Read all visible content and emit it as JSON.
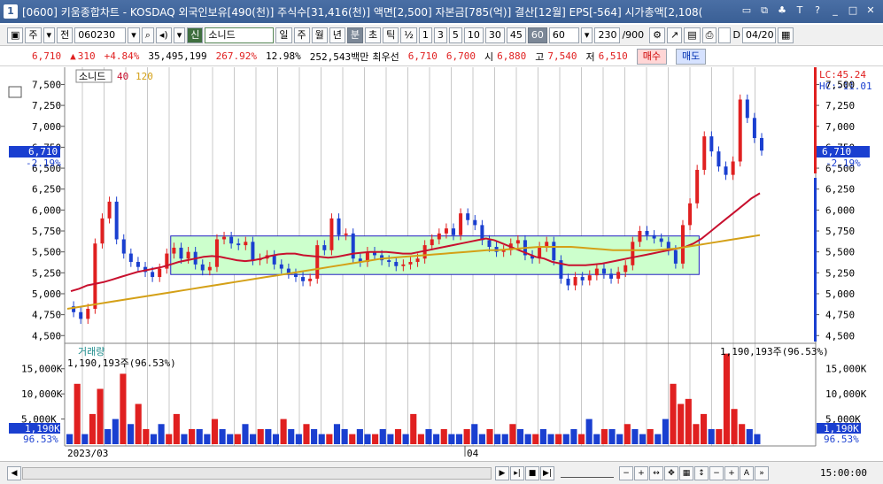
{
  "window": {
    "badge": "1",
    "title": "[0600] 키움종합차트 - KOSDAQ 외국인보유[490(천)] 주식수[31,416(천)] 액면[2,500] 자본금[785(억)] 결산[12월] EPS[-564] 시가총액[2,108(",
    "buttons": [
      "▭",
      "⧉",
      "♣",
      "T",
      "?",
      "_",
      "□",
      "✕"
    ]
  },
  "toolbar": {
    "period_label": "주",
    "prev_label": "전",
    "code": "060230",
    "name_tag": "신",
    "name": "소니드",
    "periods": [
      "일",
      "주",
      "월",
      "년",
      "분",
      "초",
      "틱"
    ],
    "active_period": "분",
    "half": "½",
    "intervals": [
      "1",
      "3",
      "5",
      "10",
      "30",
      "45",
      "60"
    ],
    "active_interval": "60",
    "interval_value": "60",
    "count": "230",
    "count_max": "/900",
    "d_label": "D",
    "date": "04/20"
  },
  "quote": {
    "price": "6,710",
    "change_arrow": "▲",
    "change": "310",
    "change_pct": "+4.84%",
    "volume": "35,495,199",
    "vol_ratio": "267.92%",
    "turnover": "12.98%",
    "amount": "252,543백만",
    "best_ask_label": "최우선",
    "best_ask": "6,710",
    "best_bid": "6,700",
    "open_label": "시",
    "open": "6,880",
    "high_label": "고",
    "high": "7,540",
    "low_label": "저",
    "low": "6,510",
    "buy_label": "매수",
    "sell_label": "매도"
  },
  "legend": {
    "name": "소니드",
    "ma1": "40",
    "ma2": "120",
    "lc": "LC:45.24",
    "hc": "HC:-11.01",
    "volume_title": "거래량",
    "volume_value": "1,190,193주(96.53%)",
    "volume_value_right": "1,190,193주(96.53%)"
  },
  "price_axis": {
    "ticks": [
      "7,500",
      "7,250",
      "7,000",
      "6,750",
      "6,500",
      "6,250",
      "6,000",
      "5,750",
      "5,500",
      "5,250",
      "5,000",
      "4,750",
      "4,500"
    ],
    "current_price": "6,710",
    "current_pct": "-2.19%"
  },
  "volume_axis": {
    "ticks": [
      "15,000K",
      "10,000K",
      "5,000K"
    ],
    "current": "1,190K",
    "current_pct": "96.53%"
  },
  "time_axis": {
    "labels": [
      "2023/03",
      "04"
    ],
    "time": "15:00:00"
  },
  "colors": {
    "up": "#e02020",
    "down": "#1a3fd0",
    "ma40": "#c8102e",
    "ma120": "#d4a017",
    "box_fill": "#ccffcc",
    "box_stroke": "#2020c0"
  },
  "chart_data": {
    "type": "candlestick",
    "y_range": [
      4450,
      7600
    ],
    "volume_range": [
      0,
      19000
    ],
    "price_path": [
      4850,
      4780,
      4700,
      4820,
      5600,
      5900,
      6100,
      5650,
      5480,
      5380,
      5320,
      5260,
      5200,
      5300,
      5480,
      5550,
      5420,
      5500,
      5350,
      5280,
      5320,
      5650,
      5680,
      5600,
      5580,
      5620,
      5400,
      5420,
      5460,
      5350,
      5300,
      5240,
      5200,
      5150,
      5180,
      5580,
      5520,
      5900,
      5700,
      5720,
      5420,
      5380,
      5500,
      5460,
      5400,
      5380,
      5330,
      5350,
      5380,
      5420,
      5580,
      5650,
      5720,
      5780,
      5700,
      5960,
      5880,
      5820,
      5640,
      5560,
      5500,
      5520,
      5600,
      5640,
      5460,
      5420,
      5560,
      5620,
      5400,
      5180,
      5100,
      5200,
      5160,
      5220,
      5300,
      5240,
      5180,
      5260,
      5340,
      5620,
      5750,
      5700,
      5660,
      5620,
      5520,
      5360,
      5820,
      6080,
      6480,
      6880,
      6700,
      6520,
      6420,
      6580,
      7320,
      7100,
      6860,
      6710
    ],
    "ma40_path": [
      5030,
      5060,
      5100,
      5120,
      5140,
      5170,
      5200,
      5230,
      5260,
      5280,
      5300,
      5320,
      5350,
      5380,
      5400,
      5420,
      5440,
      5450,
      5440,
      5420,
      5400,
      5390,
      5400,
      5420,
      5450,
      5470,
      5480,
      5480,
      5460,
      5450,
      5440,
      5430,
      5440,
      5460,
      5480,
      5490,
      5500,
      5500,
      5500,
      5490,
      5480,
      5480,
      5500,
      5520,
      5540,
      5560,
      5580,
      5600,
      5620,
      5640,
      5660,
      5640,
      5600,
      5560,
      5520,
      5480,
      5440,
      5420,
      5380,
      5360,
      5340,
      5340,
      5340,
      5350,
      5360,
      5380,
      5400,
      5420,
      5440,
      5460,
      5480,
      5500,
      5520,
      5540,
      5560,
      5600,
      5660,
      5740,
      5820,
      5900,
      5980,
      6060,
      6140,
      6200
    ],
    "ma120_path": [
      4820,
      4840,
      4860,
      4880,
      4900,
      4920,
      4940,
      4960,
      4980,
      5000,
      5020,
      5040,
      5060,
      5080,
      5100,
      5120,
      5140,
      5160,
      5180,
      5200,
      5220,
      5240,
      5260,
      5280,
      5300,
      5320,
      5340,
      5360,
      5380,
      5400,
      5420,
      5430,
      5440,
      5450,
      5460,
      5470,
      5480,
      5490,
      5500,
      5510,
      5520,
      5520,
      5530,
      5540,
      5550,
      5560,
      5560,
      5560,
      5560,
      5550,
      5540,
      5530,
      5520,
      5520,
      5520,
      5520,
      5520,
      5530,
      5540,
      5560,
      5580,
      5600,
      5620,
      5640,
      5660,
      5680,
      5700
    ],
    "box": {
      "price_top": 5690,
      "price_bottom": 5230
    },
    "volume_spikes": [
      2,
      12,
      2,
      6,
      11,
      3,
      5,
      14,
      4,
      8,
      3,
      2,
      4,
      2,
      6,
      2,
      3,
      3,
      2,
      5,
      3,
      2,
      2,
      4,
      2,
      3,
      3,
      2,
      5,
      3,
      2,
      4,
      3,
      2,
      2,
      4,
      3,
      2,
      3,
      2,
      2,
      3,
      2,
      3,
      2,
      6,
      2,
      3,
      2,
      3,
      2,
      2,
      3,
      4,
      2,
      3,
      2,
      2,
      4,
      3,
      2,
      2,
      3,
      2,
      2,
      2,
      3,
      2,
      5,
      2,
      3,
      3,
      2,
      4,
      3,
      2,
      3,
      2,
      5,
      12,
      8,
      9,
      4,
      6,
      3,
      3,
      18,
      7,
      4,
      3,
      2
    ]
  }
}
